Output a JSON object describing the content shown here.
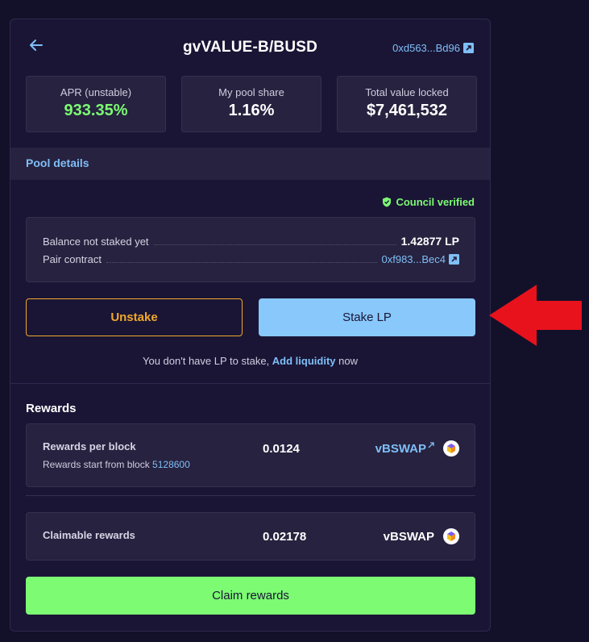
{
  "header": {
    "title": "gvVALUE-B/BUSD",
    "address": "0xd563...Bd96"
  },
  "stats": [
    {
      "label": "APR (unstable)",
      "value": "933.35%"
    },
    {
      "label": "My pool share",
      "value": "1.16%"
    },
    {
      "label": "Total value locked",
      "value": "$7,461,532"
    }
  ],
  "section": {
    "pool_details": "Pool details"
  },
  "verified": "Council verified",
  "info": {
    "balance_label": "Balance not staked yet",
    "balance_value": "1.42877 LP",
    "pair_label": "Pair contract",
    "pair_value": "0xf983...Bec4"
  },
  "buttons": {
    "unstake": "Unstake",
    "stake": "Stake LP",
    "claim": "Claim rewards"
  },
  "no_lp": {
    "prefix": "You don't have LP to stake,",
    "link": "Add liquidity",
    "suffix": "now"
  },
  "rewards": {
    "title": "Rewards",
    "per_block_label": "Rewards per block",
    "start_prefix": "Rewards start from block",
    "start_block": "5128600",
    "per_block_value": "0.0124",
    "per_block_token": "vBSWAP",
    "claimable_label": "Claimable rewards",
    "claimable_value": "0.02178",
    "claimable_token": "vBSWAP"
  },
  "colors": {
    "background": "#13102a",
    "panel": "#1a1535",
    "accent_blue": "#7fbff8",
    "accent_green": "#7cfb73",
    "accent_orange": "#f0a82b",
    "arrow_red": "#e8121c"
  },
  "icons": [
    "back-arrow-icon",
    "external-link-icon",
    "shield-check-icon",
    "vbswap-token-icon",
    "red-pointer-arrow"
  ]
}
